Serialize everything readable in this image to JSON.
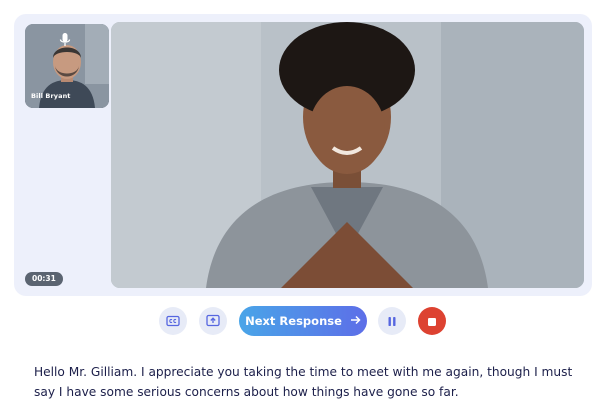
{
  "self_view": {
    "participant_name": "Bill Bryant",
    "mic_icon": "microphone-icon"
  },
  "timer": "00:31",
  "main_view": {
    "description_icon": "video-feed"
  },
  "controls": {
    "cc_icon": "closed-captions-icon",
    "share_icon": "share-screen-icon",
    "next_label": "Next Response",
    "next_icon": "arrow-right-icon",
    "pause_icon": "pause-icon",
    "stop_icon": "stop-icon"
  },
  "transcript": "Hello Mr. Gilliam. I appreciate you taking the time to meet with me again, though I must say I have some serious concerns about how things have gone so far.",
  "colors": {
    "accent_start": "#49a5e8",
    "accent_end": "#5d6ee8",
    "stop": "#dd4231",
    "text": "#1c1f4a"
  }
}
